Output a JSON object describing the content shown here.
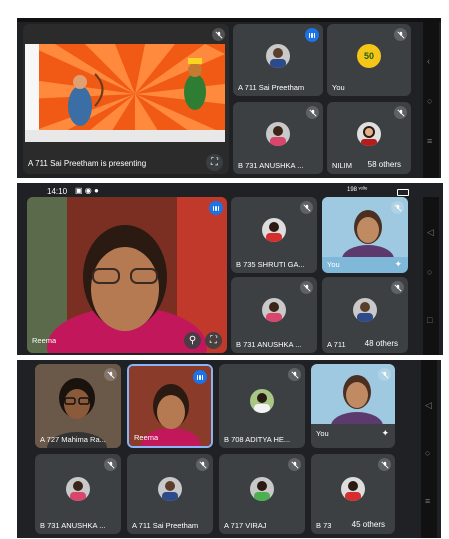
{
  "panel1": {
    "presenting_caption": "A 711 Sai Preetham is presenting",
    "participants": [
      {
        "name": "A 711 Sai Preetham"
      },
      {
        "name": "You",
        "badge": "50"
      },
      {
        "name": "B 731 ANUSHKA ..."
      },
      {
        "name": "NILIM"
      }
    ],
    "others_label": "58 others"
  },
  "panel2": {
    "status_time": "14:10",
    "status_right": "198 ᵛᵒˡᵗᵉ",
    "main_speaker": "Reema",
    "participants": [
      {
        "name": "B 735 SHRUTI GA..."
      },
      {
        "name": "You"
      },
      {
        "name": "B 731 ANUSHKA ..."
      },
      {
        "name": "A 711"
      }
    ],
    "others_label": "48 others"
  },
  "panel3": {
    "participants": [
      {
        "name": "A 727 Mahima Ra..."
      },
      {
        "name": "Reema"
      },
      {
        "name": "B 708 ADITYA HE..."
      },
      {
        "name": "You"
      },
      {
        "name": "B 731 ANUSHKA ..."
      },
      {
        "name": "A 711 Sai Preetham"
      },
      {
        "name": "A 717 VIRAJ"
      },
      {
        "name": "B 73"
      }
    ],
    "others_label": "45 others"
  },
  "colors": {
    "tile": "#3c4043",
    "bg": "#202124",
    "accent": "#1a73e8",
    "slide": "#f05a14"
  }
}
